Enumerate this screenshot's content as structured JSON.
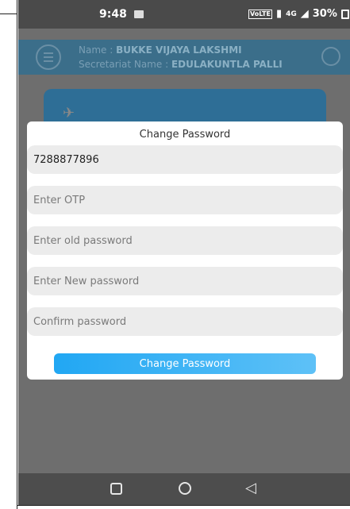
{
  "status_bar": {
    "time": "9:48",
    "volte_label": "VoLTE",
    "signal_label": "4G",
    "battery_percent": "30%"
  },
  "header": {
    "name_label": "Name : ",
    "name_value": "BUKKE VIJAYA LAKSHMI",
    "secretariat_label": "Secretariat Name : ",
    "secretariat_value": "EDULAKUNTLA PALLI"
  },
  "modal": {
    "title": "Change Password",
    "mobile_value": "7288877896",
    "otp_placeholder": "Enter OTP",
    "old_password_placeholder": "Enter old password",
    "new_password_placeholder": "Enter New password",
    "confirm_password_placeholder": "Confirm password",
    "submit_label": "Change Password"
  },
  "colors": {
    "accent": "#21a7f3",
    "header_bg": "#3b6e8a",
    "overlay": "#6e6e6e"
  },
  "icons": {
    "menu": "hamburger-menu-icon",
    "logout": "logout-icon",
    "card": "satellite-icon",
    "nav_recent": "square-icon",
    "nav_home": "circle-icon",
    "nav_back": "triangle-back-icon"
  }
}
